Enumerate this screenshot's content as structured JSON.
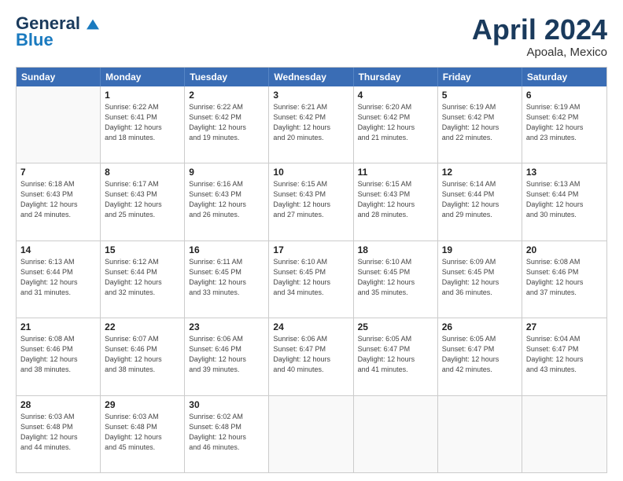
{
  "logo": {
    "line1": "General",
    "line2": "Blue"
  },
  "title": "April 2024",
  "location": "Apoala, Mexico",
  "header_days": [
    "Sunday",
    "Monday",
    "Tuesday",
    "Wednesday",
    "Thursday",
    "Friday",
    "Saturday"
  ],
  "rows": [
    [
      {
        "day": "",
        "info": ""
      },
      {
        "day": "1",
        "info": "Sunrise: 6:22 AM\nSunset: 6:41 PM\nDaylight: 12 hours\nand 18 minutes."
      },
      {
        "day": "2",
        "info": "Sunrise: 6:22 AM\nSunset: 6:42 PM\nDaylight: 12 hours\nand 19 minutes."
      },
      {
        "day": "3",
        "info": "Sunrise: 6:21 AM\nSunset: 6:42 PM\nDaylight: 12 hours\nand 20 minutes."
      },
      {
        "day": "4",
        "info": "Sunrise: 6:20 AM\nSunset: 6:42 PM\nDaylight: 12 hours\nand 21 minutes."
      },
      {
        "day": "5",
        "info": "Sunrise: 6:19 AM\nSunset: 6:42 PM\nDaylight: 12 hours\nand 22 minutes."
      },
      {
        "day": "6",
        "info": "Sunrise: 6:19 AM\nSunset: 6:42 PM\nDaylight: 12 hours\nand 23 minutes."
      }
    ],
    [
      {
        "day": "7",
        "info": "Sunrise: 6:18 AM\nSunset: 6:43 PM\nDaylight: 12 hours\nand 24 minutes."
      },
      {
        "day": "8",
        "info": "Sunrise: 6:17 AM\nSunset: 6:43 PM\nDaylight: 12 hours\nand 25 minutes."
      },
      {
        "day": "9",
        "info": "Sunrise: 6:16 AM\nSunset: 6:43 PM\nDaylight: 12 hours\nand 26 minutes."
      },
      {
        "day": "10",
        "info": "Sunrise: 6:15 AM\nSunset: 6:43 PM\nDaylight: 12 hours\nand 27 minutes."
      },
      {
        "day": "11",
        "info": "Sunrise: 6:15 AM\nSunset: 6:43 PM\nDaylight: 12 hours\nand 28 minutes."
      },
      {
        "day": "12",
        "info": "Sunrise: 6:14 AM\nSunset: 6:44 PM\nDaylight: 12 hours\nand 29 minutes."
      },
      {
        "day": "13",
        "info": "Sunrise: 6:13 AM\nSunset: 6:44 PM\nDaylight: 12 hours\nand 30 minutes."
      }
    ],
    [
      {
        "day": "14",
        "info": "Sunrise: 6:13 AM\nSunset: 6:44 PM\nDaylight: 12 hours\nand 31 minutes."
      },
      {
        "day": "15",
        "info": "Sunrise: 6:12 AM\nSunset: 6:44 PM\nDaylight: 12 hours\nand 32 minutes."
      },
      {
        "day": "16",
        "info": "Sunrise: 6:11 AM\nSunset: 6:45 PM\nDaylight: 12 hours\nand 33 minutes."
      },
      {
        "day": "17",
        "info": "Sunrise: 6:10 AM\nSunset: 6:45 PM\nDaylight: 12 hours\nand 34 minutes."
      },
      {
        "day": "18",
        "info": "Sunrise: 6:10 AM\nSunset: 6:45 PM\nDaylight: 12 hours\nand 35 minutes."
      },
      {
        "day": "19",
        "info": "Sunrise: 6:09 AM\nSunset: 6:45 PM\nDaylight: 12 hours\nand 36 minutes."
      },
      {
        "day": "20",
        "info": "Sunrise: 6:08 AM\nSunset: 6:46 PM\nDaylight: 12 hours\nand 37 minutes."
      }
    ],
    [
      {
        "day": "21",
        "info": "Sunrise: 6:08 AM\nSunset: 6:46 PM\nDaylight: 12 hours\nand 38 minutes."
      },
      {
        "day": "22",
        "info": "Sunrise: 6:07 AM\nSunset: 6:46 PM\nDaylight: 12 hours\nand 38 minutes."
      },
      {
        "day": "23",
        "info": "Sunrise: 6:06 AM\nSunset: 6:46 PM\nDaylight: 12 hours\nand 39 minutes."
      },
      {
        "day": "24",
        "info": "Sunrise: 6:06 AM\nSunset: 6:47 PM\nDaylight: 12 hours\nand 40 minutes."
      },
      {
        "day": "25",
        "info": "Sunrise: 6:05 AM\nSunset: 6:47 PM\nDaylight: 12 hours\nand 41 minutes."
      },
      {
        "day": "26",
        "info": "Sunrise: 6:05 AM\nSunset: 6:47 PM\nDaylight: 12 hours\nand 42 minutes."
      },
      {
        "day": "27",
        "info": "Sunrise: 6:04 AM\nSunset: 6:47 PM\nDaylight: 12 hours\nand 43 minutes."
      }
    ],
    [
      {
        "day": "28",
        "info": "Sunrise: 6:03 AM\nSunset: 6:48 PM\nDaylight: 12 hours\nand 44 minutes."
      },
      {
        "day": "29",
        "info": "Sunrise: 6:03 AM\nSunset: 6:48 PM\nDaylight: 12 hours\nand 45 minutes."
      },
      {
        "day": "30",
        "info": "Sunrise: 6:02 AM\nSunset: 6:48 PM\nDaylight: 12 hours\nand 46 minutes."
      },
      {
        "day": "",
        "info": ""
      },
      {
        "day": "",
        "info": ""
      },
      {
        "day": "",
        "info": ""
      },
      {
        "day": "",
        "info": ""
      }
    ]
  ]
}
